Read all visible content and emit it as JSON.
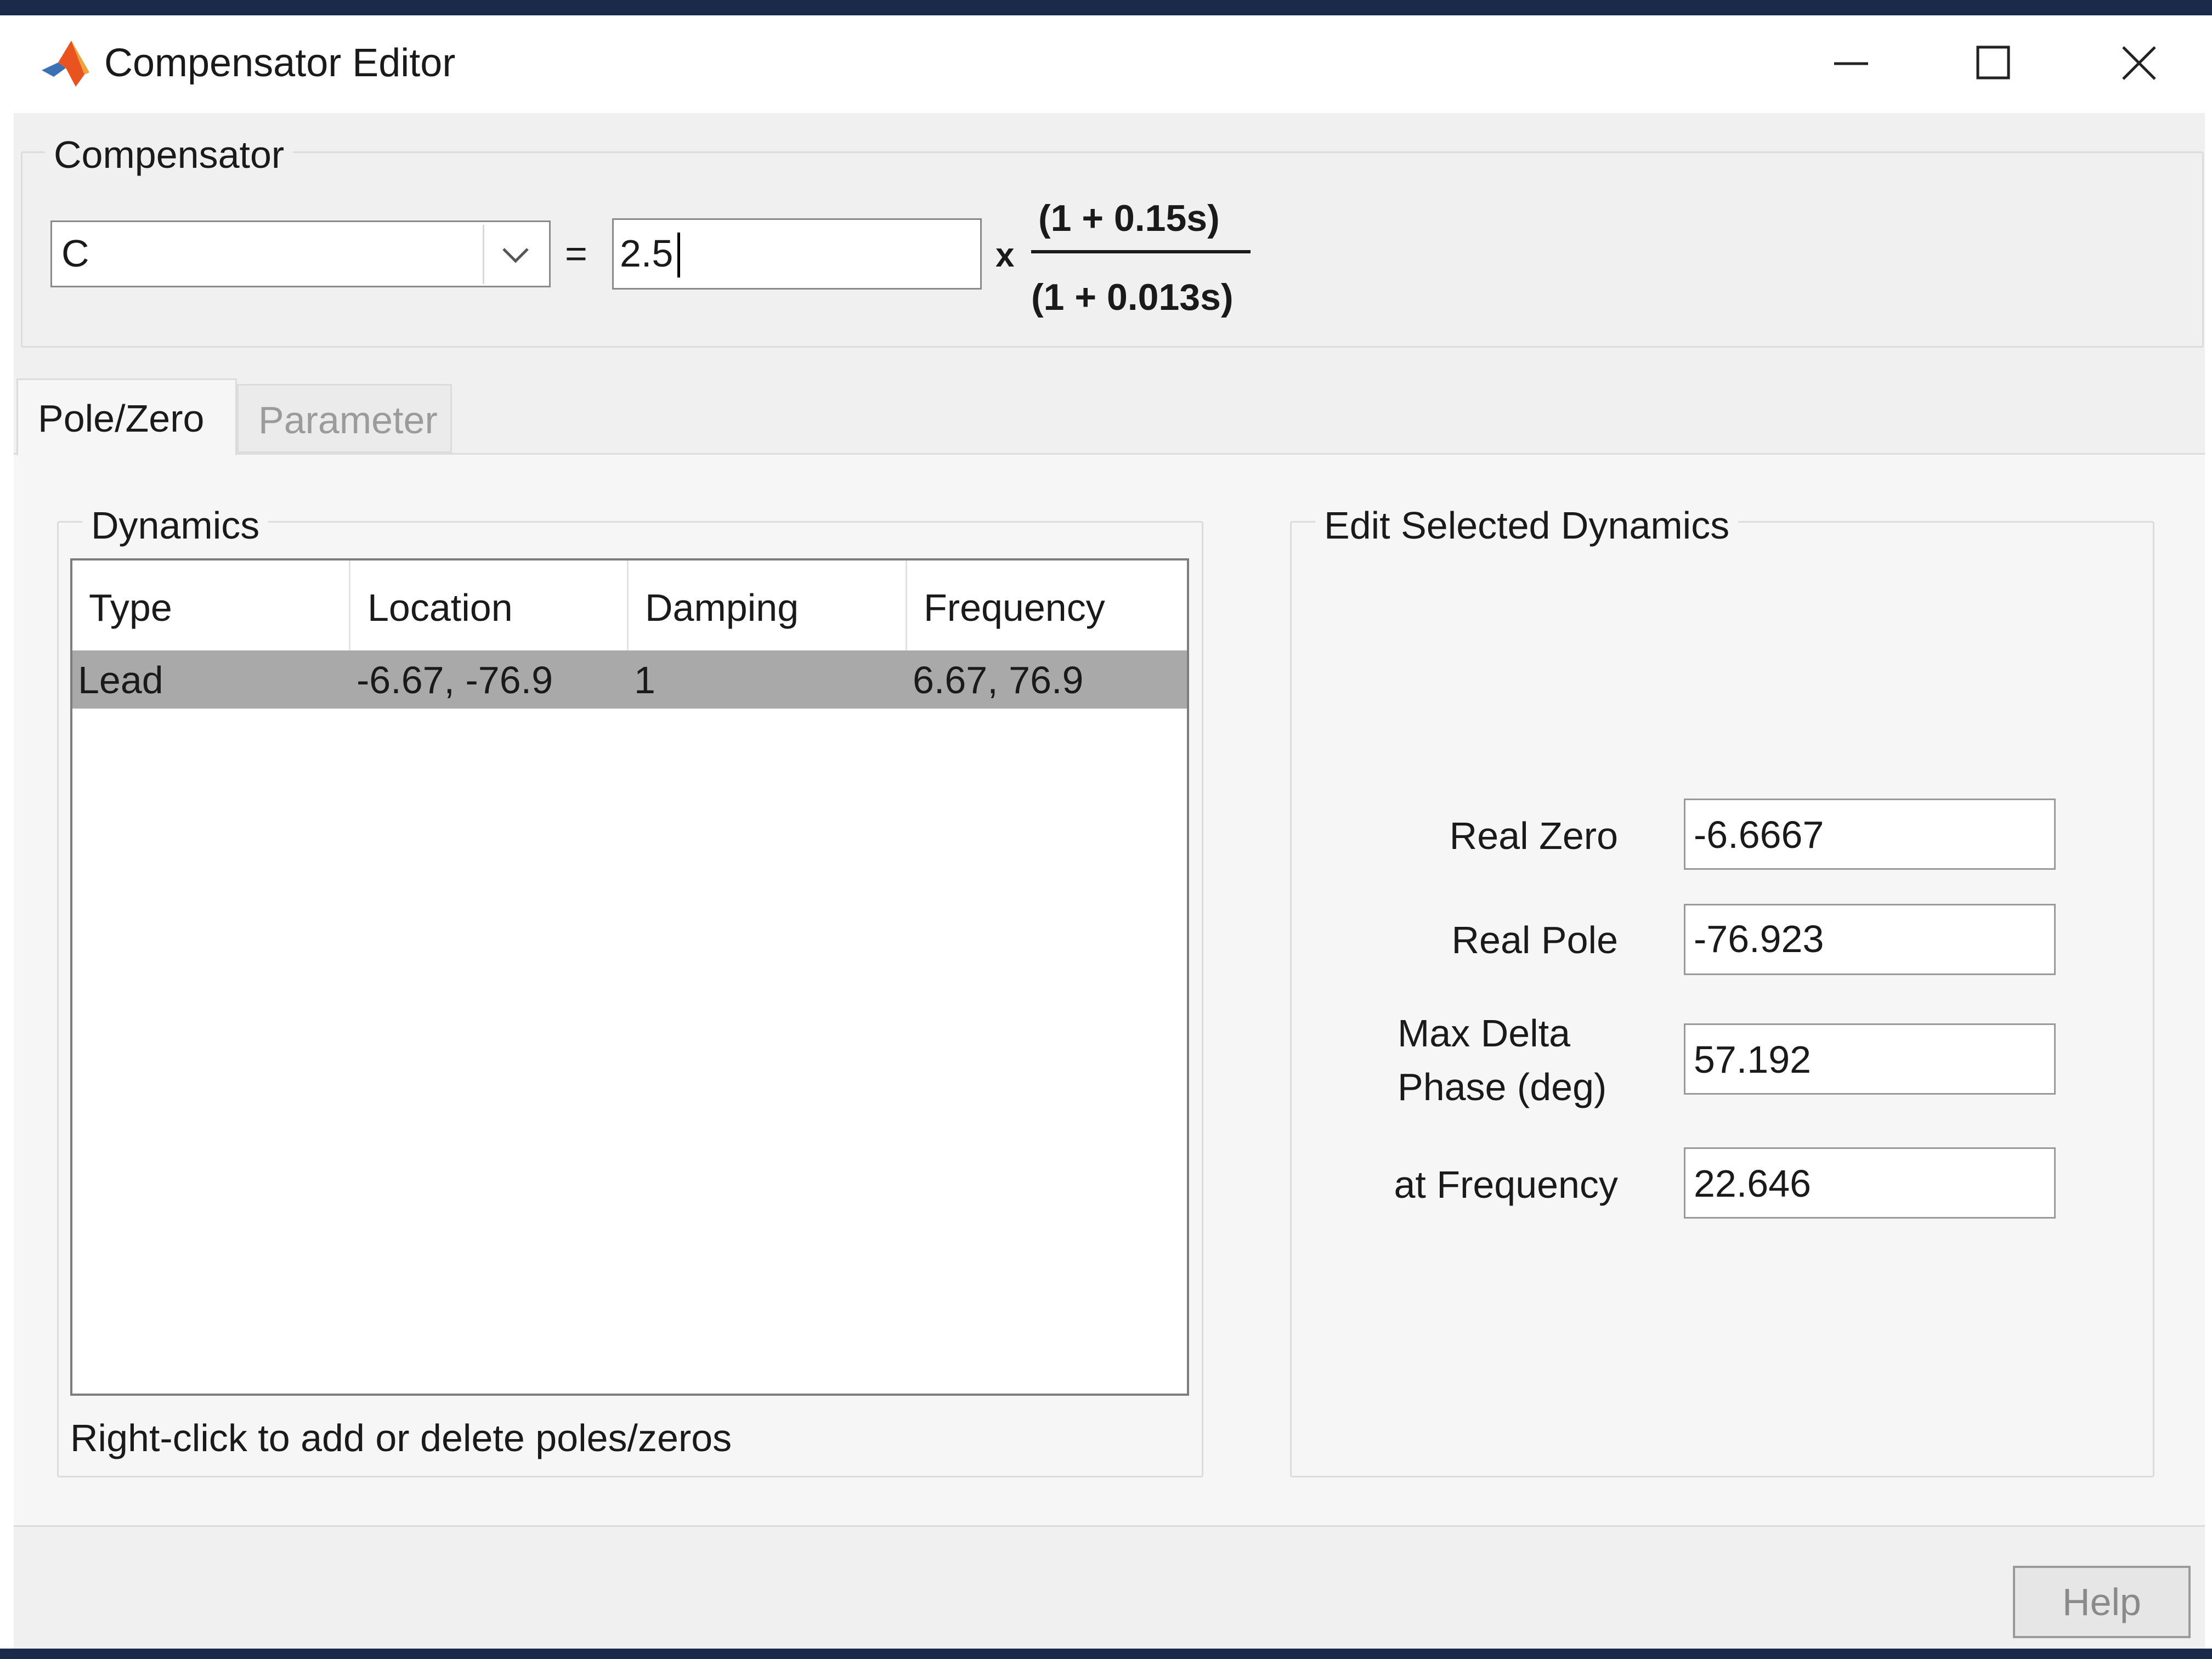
{
  "window": {
    "title": "Compensator Editor",
    "controls": {
      "minimize": "minimize",
      "maximize": "maximize",
      "close": "close"
    }
  },
  "compensator": {
    "group_label": "Compensator",
    "selector_value": "C",
    "equals": "=",
    "gain": "2.5",
    "times": "x",
    "numerator": "(1 + 0.15s)",
    "denominator": "(1 + 0.013s)"
  },
  "tabs": [
    {
      "label": "Pole/Zero",
      "active": true
    },
    {
      "label": "Parameter",
      "active": false
    }
  ],
  "dynamics": {
    "group_label": "Dynamics",
    "columns": [
      "Type",
      "Location",
      "Damping",
      "Frequency"
    ],
    "rows": [
      {
        "type": "Lead",
        "location": "-6.67, -76.9",
        "damping": "1",
        "frequency": "6.67, 76.9"
      }
    ],
    "hint": "Right-click to add or delete poles/zeros"
  },
  "edit": {
    "group_label": "Edit Selected Dynamics",
    "real_zero_label": "Real Zero",
    "real_zero": "-6.6667",
    "real_pole_label": "Real Pole",
    "real_pole": "-76.923",
    "max_delta_label_1": "Max Delta",
    "max_delta_label_2": "Phase (deg)",
    "max_delta": "57.192",
    "at_freq_label": "at Frequency",
    "at_freq": "22.646"
  },
  "footer": {
    "help_label": "Help"
  },
  "colors": {
    "frame": "#1b2a4a",
    "selected_row": "#a9a9a9",
    "panel": "#f0f0f0"
  }
}
